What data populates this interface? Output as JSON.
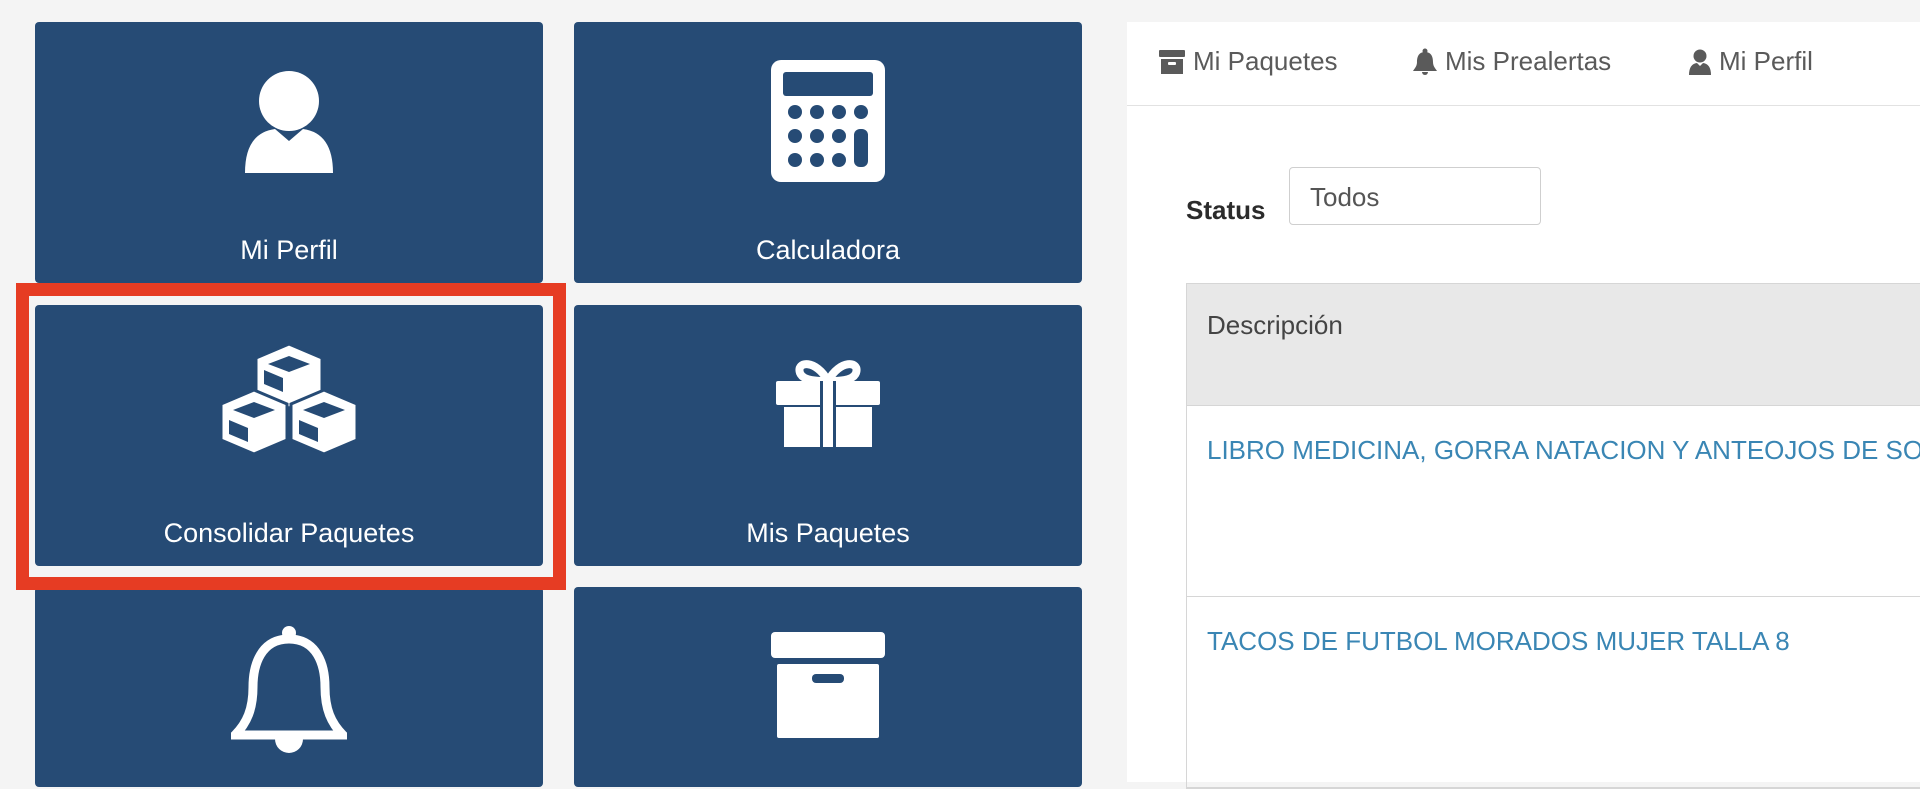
{
  "tiles": {
    "perfil": {
      "label": "Mi Perfil",
      "icon": "user-icon"
    },
    "calculadora": {
      "label": "Calculadora",
      "icon": "calculator-icon"
    },
    "consolidar": {
      "label": "Consolidar Paquetes",
      "icon": "cubes-icon"
    },
    "paquetes": {
      "label": "Mis Paquetes",
      "icon": "gift-icon"
    },
    "alertas": {
      "label": "",
      "icon": "bell-icon"
    },
    "archivo": {
      "label": "",
      "icon": "archive-icon"
    }
  },
  "nav": {
    "paquetes": "Mi Paquetes",
    "prealertas": "Mis Prealertas",
    "perfil": "Mi Perfil"
  },
  "filter": {
    "status_label": "Status",
    "status_value": "Todos"
  },
  "table": {
    "header": "Descripción",
    "rows": [
      "LIBRO MEDICINA, GORRA NATACION Y ANTEOJOS DE SOL",
      "TACOS DE FUTBOL MORADOS MUJER TALLA 8"
    ]
  },
  "colors": {
    "tile": "#264b75",
    "highlight": "#e63c23",
    "link": "#3a86b4"
  }
}
